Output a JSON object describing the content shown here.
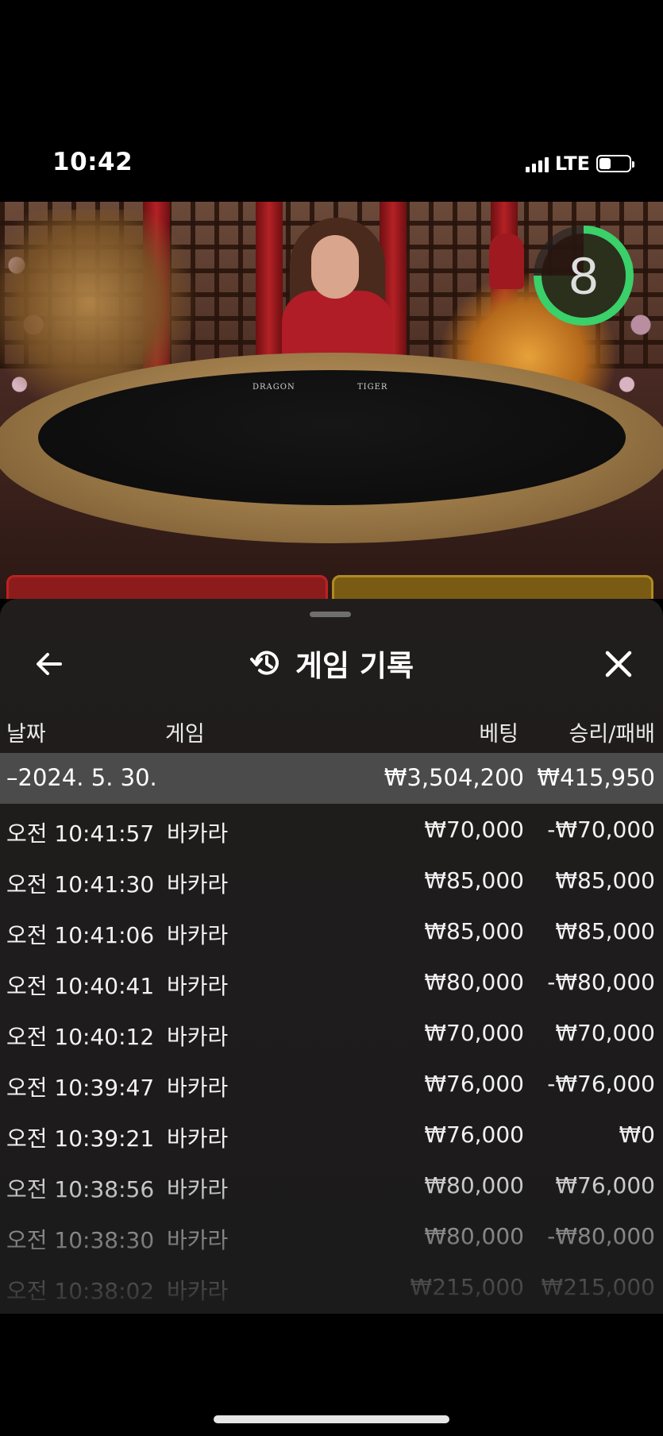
{
  "status_bar": {
    "time": "10:42",
    "network": "LTE",
    "battery_level": 0.4
  },
  "video": {
    "timer_value": "8",
    "timer_progress": 0.75,
    "table_label_left": "DRAGON",
    "table_label_right": "TIGER",
    "accent_green": "#3ad06a"
  },
  "sheet": {
    "title": "게임 기록",
    "back_icon": "arrow-left-icon",
    "history_icon": "history-icon",
    "close_icon": "close-icon",
    "columns": {
      "date": "날짜",
      "game": "게임",
      "bet": "베팅",
      "win_loss": "승리/패배"
    },
    "date_summary": {
      "date": "–2024. 5. 30.",
      "total_bet": "₩3,504,200",
      "total_win_loss": "₩415,950"
    },
    "rows": [
      {
        "time": "오전 10:41:57",
        "game": "바카라",
        "bet": "₩70,000",
        "result": "-₩70,000"
      },
      {
        "time": "오전 10:41:30",
        "game": "바카라",
        "bet": "₩85,000",
        "result": "₩85,000"
      },
      {
        "time": "오전 10:41:06",
        "game": "바카라",
        "bet": "₩85,000",
        "result": "₩85,000"
      },
      {
        "time": "오전 10:40:41",
        "game": "바카라",
        "bet": "₩80,000",
        "result": "-₩80,000"
      },
      {
        "time": "오전 10:40:12",
        "game": "바카라",
        "bet": "₩70,000",
        "result": "₩70,000"
      },
      {
        "time": "오전 10:39:47",
        "game": "바카라",
        "bet": "₩76,000",
        "result": "-₩76,000"
      },
      {
        "time": "오전 10:39:21",
        "game": "바카라",
        "bet": "₩76,000",
        "result": "₩0"
      },
      {
        "time": "오전 10:38:56",
        "game": "바카라",
        "bet": "₩80,000",
        "result": "₩76,000"
      },
      {
        "time": "오전 10:38:30",
        "game": "바카라",
        "bet": "₩80,000",
        "result": "-₩80,000"
      },
      {
        "time": "오전 10:38:02",
        "game": "바카라",
        "bet": "₩215,000",
        "result": "₩215,000"
      }
    ]
  }
}
